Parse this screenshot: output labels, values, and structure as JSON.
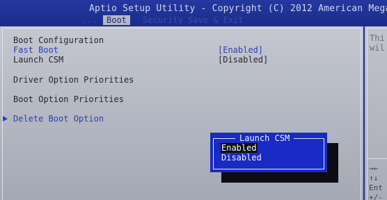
{
  "title_bar": {
    "title": "Aptio Setup Utility - Copyright (C) 2012 American Mega",
    "tab_left": "...",
    "tab_active": "Boot",
    "tab_right": "Security    Save & Exit"
  },
  "main": {
    "section_heading": "Boot Configuration",
    "fast_boot": {
      "label": "Fast Boot",
      "value": "[Enabled]"
    },
    "launch_csm": {
      "label": "Launch CSM",
      "value": "[Disabled]"
    },
    "driver_option_priorities": "Driver Option Priorities",
    "boot_option_priorities": "Boot Option Priorities",
    "delete_boot_option": "Delete Boot Option"
  },
  "help": {
    "line1": "Thi",
    "line2": "wil",
    "key_lr": "→←",
    "key_ud": "↑↓",
    "key_enter": "Ent",
    "key_pm": "+/-"
  },
  "popup": {
    "title": "Launch CSM",
    "options": [
      "Enabled",
      "Disabled"
    ],
    "selected": "Enabled"
  },
  "colors": {
    "background_blue": "#1c2c8c",
    "panel_gray": "#b6bac5",
    "highlight_blue": "#2e3fae",
    "popup_blue": "#1a2ac4"
  }
}
